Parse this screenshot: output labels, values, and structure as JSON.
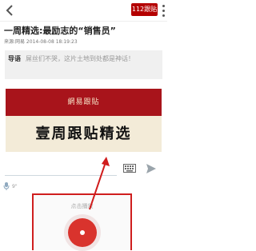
{
  "header": {
    "badge_text": "112跟贴",
    "accent_color": "#b40000",
    "back_icon": "back-arrow-icon",
    "menu_icon": "more-vertical-icon"
  },
  "article": {
    "title": "一周精选:最励志的“销售员”",
    "meta": "来源:网易    2014-08-08 18:19:23",
    "intro_label": "导语",
    "intro_text": "屌丝们不哭，这片土地到处都是神话！"
  },
  "banner": {
    "top_text": "網易跟貼",
    "main_text": "壹周跟贴精选",
    "top_color": "#a8141b",
    "main_bg": "#f3ebd8"
  },
  "composer": {
    "keyboard_icon": "keyboard-icon",
    "send_icon": "send-icon",
    "mic_icon": "microphone-icon",
    "duration": "9\""
  },
  "voice": {
    "label": "点击播放",
    "button_icon": "record-play-icon",
    "button_color": "#d9332d",
    "highlight_color": "#cf1e1e"
  }
}
